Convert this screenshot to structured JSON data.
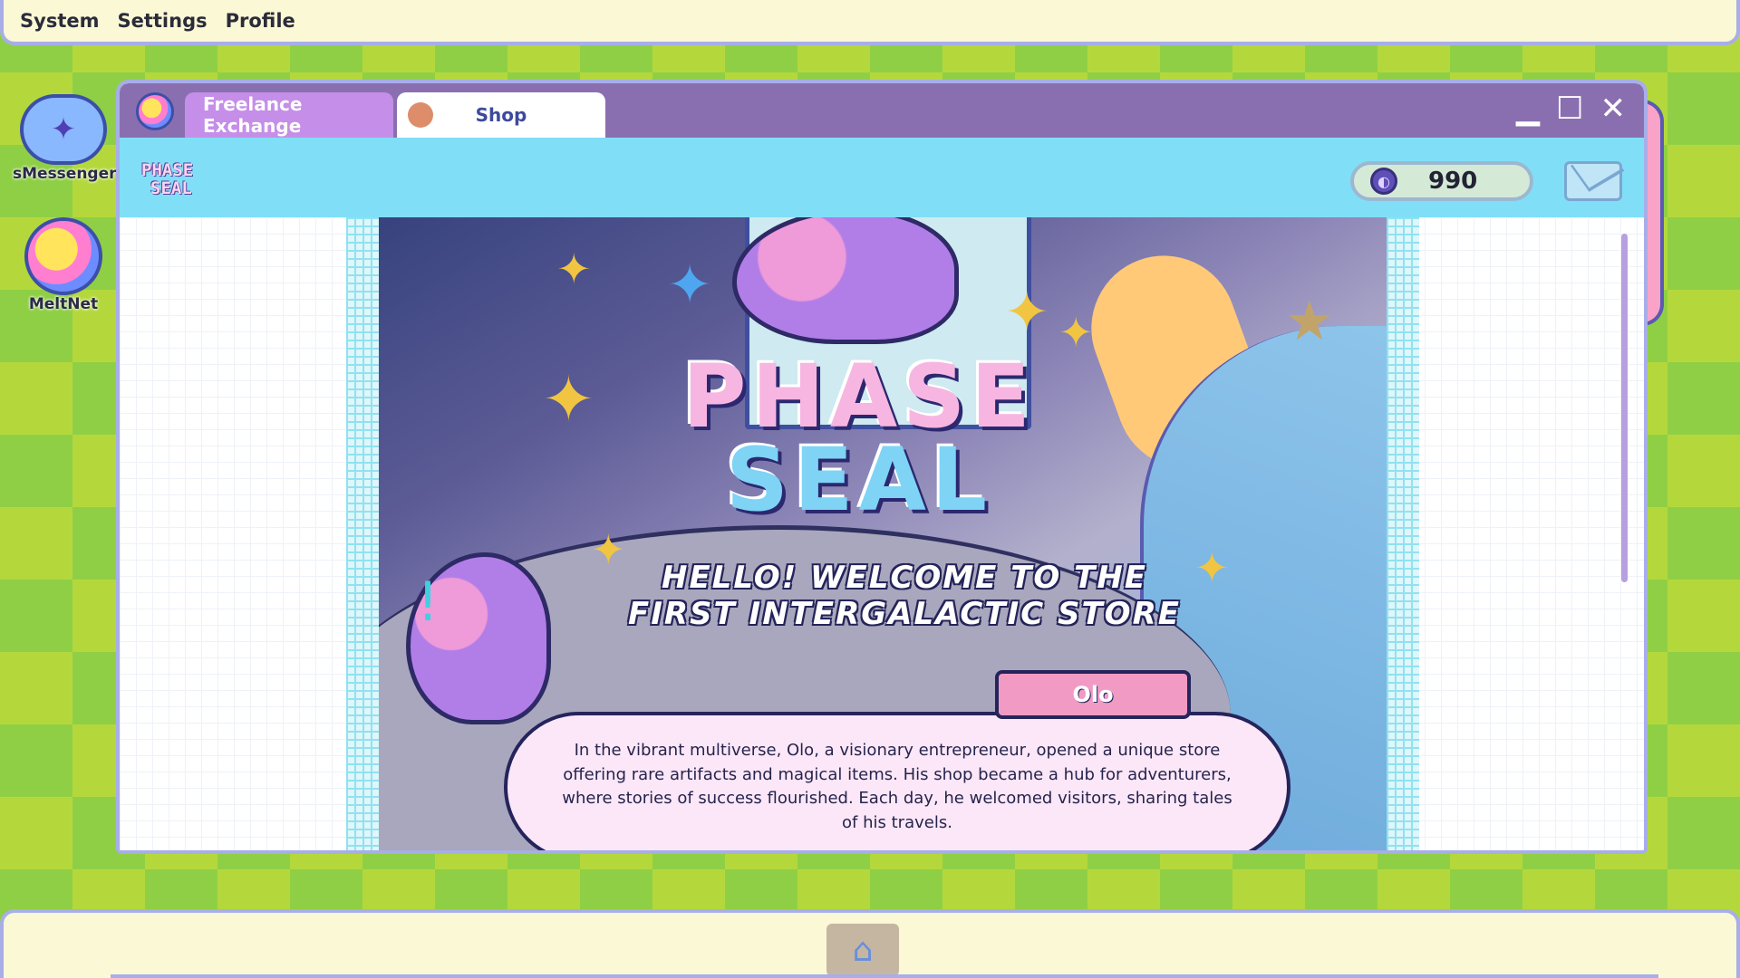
{
  "menubar": {
    "items": [
      "System",
      "Settings",
      "Profile"
    ]
  },
  "desktop": {
    "icons": [
      {
        "label": "sMessenger",
        "icon": "messenger-icon"
      },
      {
        "label": "MeltNet",
        "icon": "meltnet-icon"
      }
    ]
  },
  "window": {
    "tabs": [
      {
        "label": "Freelance Exchange",
        "active": true
      },
      {
        "label": "Shop",
        "active": false
      }
    ],
    "controls": {
      "minimize": "▁",
      "maximize": "☐",
      "close": "✕"
    }
  },
  "header": {
    "brand_line1": "PHASE",
    "brand_line2": "SEAL",
    "coins": "990"
  },
  "banner": {
    "title_line1": "PHASE",
    "title_line2": "SEAL",
    "welcome_line1": "HELLO! WELCOME TO THE",
    "welcome_line2": "FIRST INTERGALACTIC STORE",
    "speaker": "Olo",
    "story": "In the vibrant multiverse, Olo, a visionary entrepreneur, opened a unique store offering rare artifacts and magical items. His shop became a hub for adventurers, where stories of success flourished. Each day, he welcomed visitors, sharing tales of his travels."
  },
  "colors": {
    "accent": "#8a6fb0",
    "header": "#80dff7",
    "tab_active": "#c58ee8",
    "name_tag": "#f19bc4"
  }
}
